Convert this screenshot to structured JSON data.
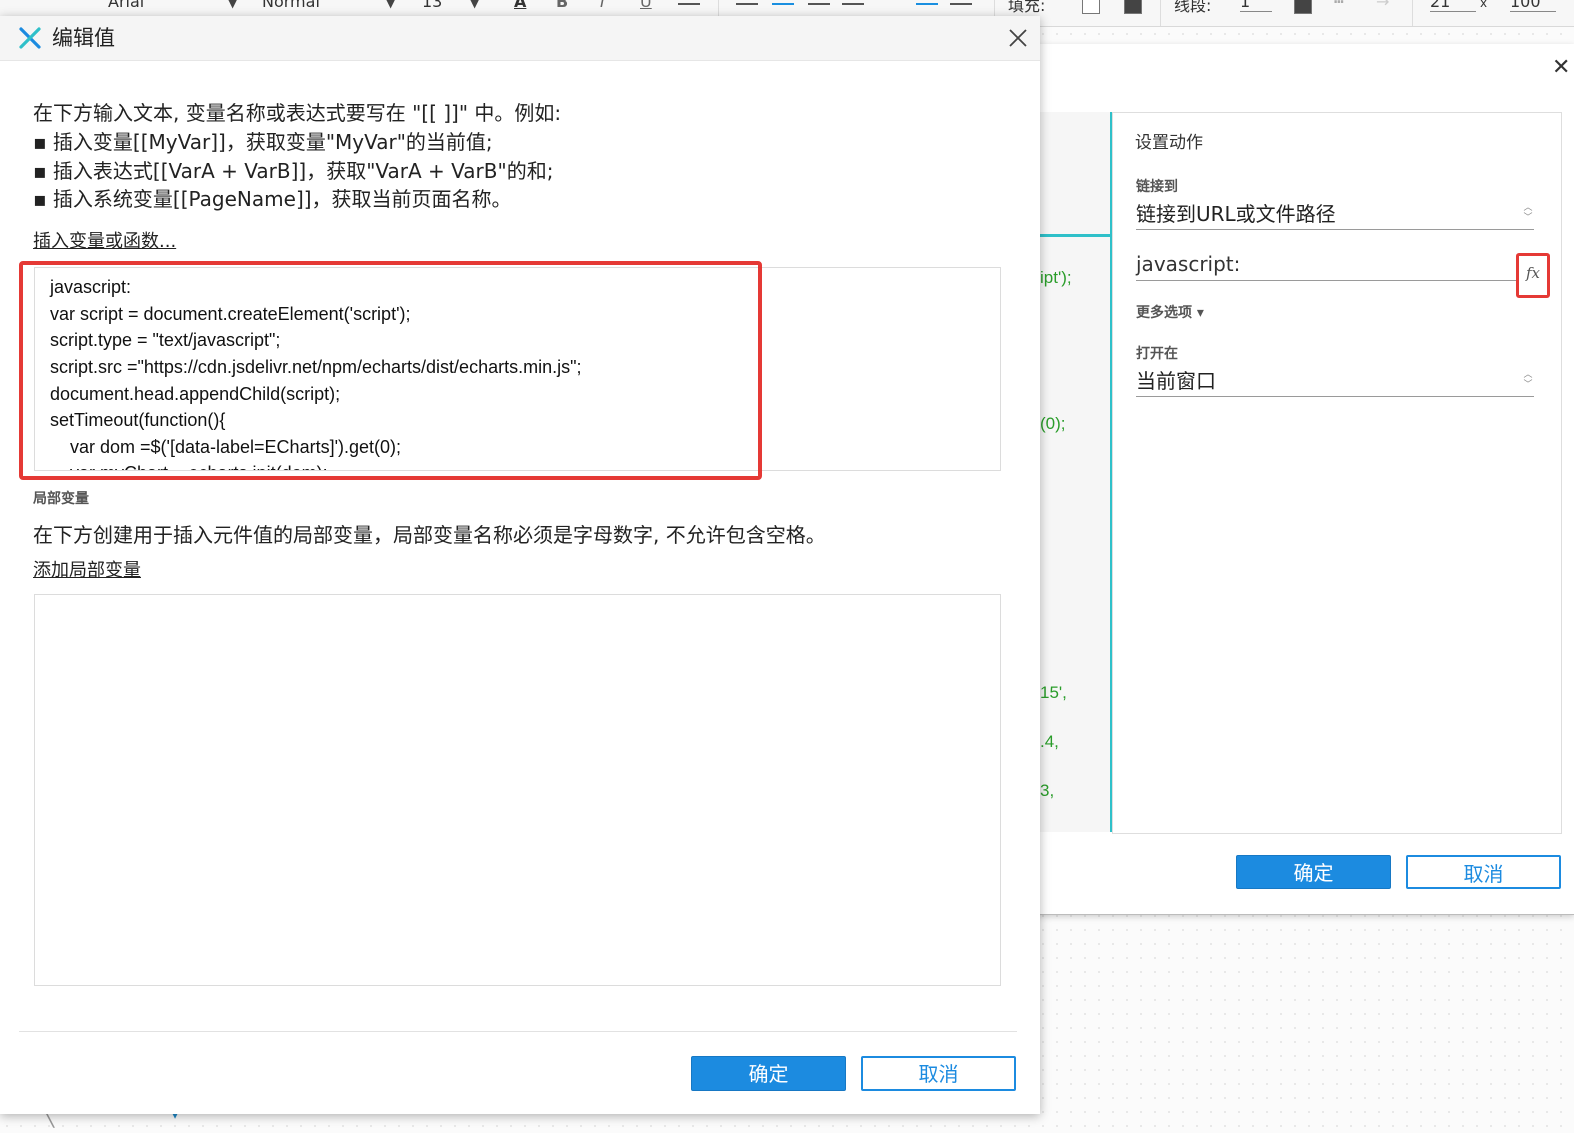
{
  "toolbar": {
    "font_family": "Arial",
    "font_style": "Normal",
    "font_size": "13",
    "fill_label": "填充:",
    "line_label": "线段:",
    "line_width": "1",
    "size_w": "21",
    "size_x": "x",
    "size_h": "100"
  },
  "action_dialog": {
    "section_title": "设置动作",
    "link_to_label": "链接到",
    "link_to_value": "链接到URL或文件路径",
    "url_value": "javascript:",
    "fx_label": "fx",
    "more_options": "更多选项 ▾",
    "open_in_label": "打开在",
    "open_in_value": "当前窗口",
    "ok": "确定",
    "cancel": "取消",
    "code_fragments": [
      "ipt');",
      "(0);",
      "15',",
      ".4,",
      "3,"
    ]
  },
  "edit_dialog": {
    "title": "编辑值",
    "instructions": [
      "在下方输入文本, 变量名称或表达式要写在 \"[[ ]]\" 中。例如:",
      "▪ 插入变量[[MyVar]]，获取变量\"MyVar\"的当前值;",
      "▪ 插入表达式[[VarA + VarB]]，获取\"VarA + VarB\"的和;",
      "▪ 插入系统变量[[PageName]]，获取当前页面名称。"
    ],
    "insert_link": "插入变量或函数...",
    "code_lines": [
      "javascript:",
      "var script = document.createElement('script');",
      "script.type = \"text/javascript\";",
      "script.src =\"https://cdn.jsdelivr.net/npm/echarts/dist/echarts.min.js\";",
      "document.head.appendChild(script);",
      "setTimeout(function(){",
      "    var dom =$('[data-label=ECharts]').get(0);",
      "    var myChart = echarts.init(dom);"
    ],
    "local_vars_label": "局部变量",
    "local_vars_desc": "在下方创建用于插入元件值的局部变量，局部变量名称必须是字母数字, 不允许包含空格。",
    "add_local_var": "添加局部变量",
    "ok": "确定",
    "cancel": "取消"
  }
}
